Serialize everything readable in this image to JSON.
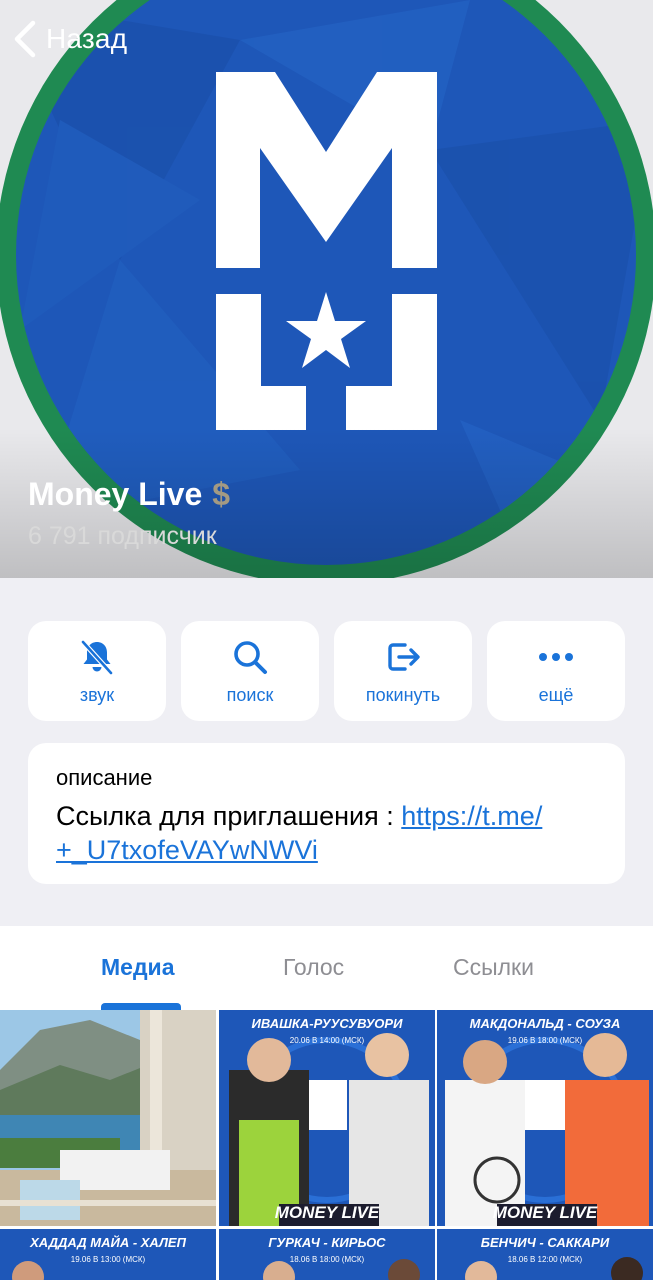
{
  "header": {
    "back_label": "Назад",
    "channel_title": "Money Live",
    "title_badge": "$",
    "subscribers": "6 791 подписчик",
    "avatar_monogram": "M L"
  },
  "actions": [
    {
      "label": "звук",
      "icon": "bell-slash-icon"
    },
    {
      "label": "поиск",
      "icon": "search-icon"
    },
    {
      "label": "покинуть",
      "icon": "leave-icon"
    },
    {
      "label": "ещё",
      "icon": "more-icon"
    }
  ],
  "description": {
    "heading": "описание",
    "text": "Ссылка для приглашения : ",
    "link_line1": "https://t.me/",
    "link_line2": "+_U7txofeVAYwNWVi"
  },
  "tabs": [
    {
      "label": "Медиа",
      "active": true
    },
    {
      "label": "Голос",
      "active": false
    },
    {
      "label": "Ссылки",
      "active": false
    }
  ],
  "media": [
    {
      "type": "photo",
      "description": "balcony"
    },
    {
      "title": "ИВАШКА-РУУСУВУОРИ",
      "date": "20.06 В 14:00 (МСК)",
      "brand": "MONEY LIVE"
    },
    {
      "title": "МАКДОНАЛЬД - СОУЗА",
      "date": "19.06 В 18:00 (МСК)",
      "brand": "MONEY LIVE"
    },
    {
      "title": "ХАДДАД МАЙА - ХАЛЕП",
      "date": "19.06 В 13:00 (МСК)"
    },
    {
      "title": "ГУРКАЧ - КИРЬОС",
      "date": "18.06 В 18:00 (МСК)"
    },
    {
      "title": "БЕНЧИЧ - САККАРИ",
      "date": "18.06 В 12:00 (МСК)"
    }
  ],
  "colors": {
    "accent": "#1a73d9",
    "avatar_blue": "#1e57b8",
    "avatar_ring": "#1f8a52",
    "background": "#efeff4"
  }
}
